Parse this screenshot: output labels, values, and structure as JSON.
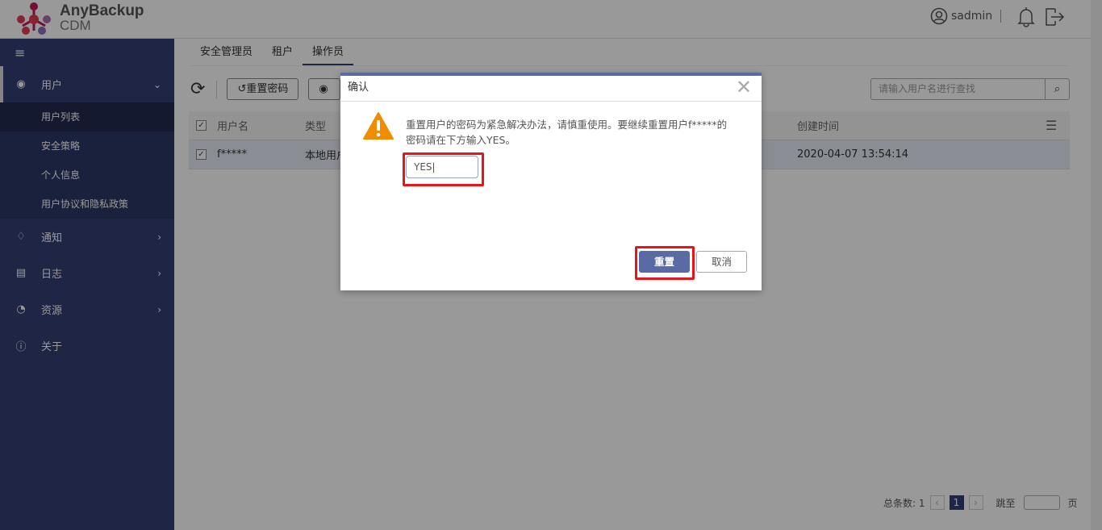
{
  "app": {
    "brand": "AnyBackup",
    "product": "CDM",
    "username": "sadmin"
  },
  "sidebar": {
    "items": [
      {
        "label": "用户",
        "icon": "user-circle-icon",
        "expanded": true,
        "children": [
          "用户列表",
          "安全策略",
          "个人信息",
          "用户协议和隐私政策"
        ],
        "selected_child": "用户列表"
      },
      {
        "label": "通知",
        "icon": "bell-icon"
      },
      {
        "label": "日志",
        "icon": "clipboard-icon"
      },
      {
        "label": "资源",
        "icon": "pie-chart-icon"
      },
      {
        "label": "关于",
        "icon": "info-icon"
      }
    ]
  },
  "tabs": [
    "安全管理员",
    "租户",
    "操作员"
  ],
  "active_tab": "操作员",
  "toolbar": {
    "reset_password": "重置密码",
    "search_placeholder": "请输入用户名进行查找"
  },
  "table": {
    "columns": [
      "用户名",
      "类型",
      "创建时间"
    ],
    "rows": [
      {
        "username": "f*****",
        "type": "本地用户",
        "created": "2020-04-07 13:54:14",
        "checked": true
      }
    ]
  },
  "pagination": {
    "total_label": "总条数: 1",
    "current": "1",
    "jump_label": "跳至",
    "page_label": "页"
  },
  "dialog": {
    "title": "确认",
    "message": "重置用户的密码为紧急解决办法，请慎重使用。要继续重置用户f*****的密码请在下方输入YES。",
    "input_value": "YES",
    "confirm": "重置",
    "cancel": "取消",
    "warning_color": "#f08c00",
    "primary_color": "#5a6aa5",
    "highlight_color": "#e8141a"
  }
}
